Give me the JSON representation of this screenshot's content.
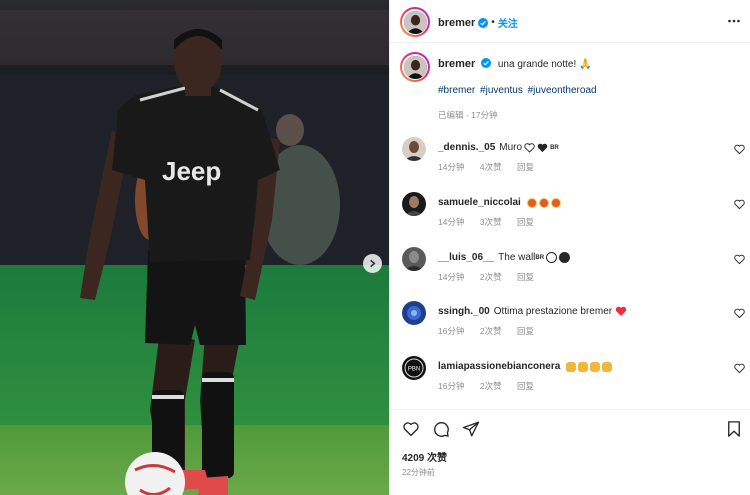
{
  "header": {
    "username": "bremer",
    "follow_label": "关注",
    "more_icon": "more-horizontal-icon"
  },
  "caption": {
    "username": "bremer",
    "text": "una grande notte! 🙏",
    "hashtags": [
      "#bremer",
      "#juventus",
      "#juveontheroad"
    ],
    "edited": "已编辑",
    "separator": "·",
    "time": "17分钟"
  },
  "comments": [
    {
      "username": "_dennis._05",
      "text": "Muro",
      "suffix": "BR",
      "time": "14分钟",
      "likes": "4次赞",
      "reply": "回复"
    },
    {
      "username": "samuele_niccolai",
      "text": "",
      "time": "14分钟",
      "likes": "3次赞",
      "reply": "回复"
    },
    {
      "username": "__luis_06__",
      "text": "The wall",
      "suffix": "BR",
      "time": "14分钟",
      "likes": "2次赞",
      "reply": "回复"
    },
    {
      "username": "ssingh._00",
      "text": "Ottima prestazione bremer",
      "time": "16分钟",
      "likes": "2次赞",
      "reply": "回复"
    },
    {
      "username": "lamiapassionebianconera",
      "text": "",
      "time": "16分钟",
      "likes": "2次赞",
      "reply": "回复"
    }
  ],
  "footer": {
    "likes": "4209 次赞",
    "posted": "22分钟前"
  },
  "photo": {
    "jersey_text": "Jeep"
  },
  "colors": {
    "accent": "#0095f6",
    "hashtag": "#00376b",
    "muted": "#8e8e8e",
    "verified": "#0095f6"
  }
}
